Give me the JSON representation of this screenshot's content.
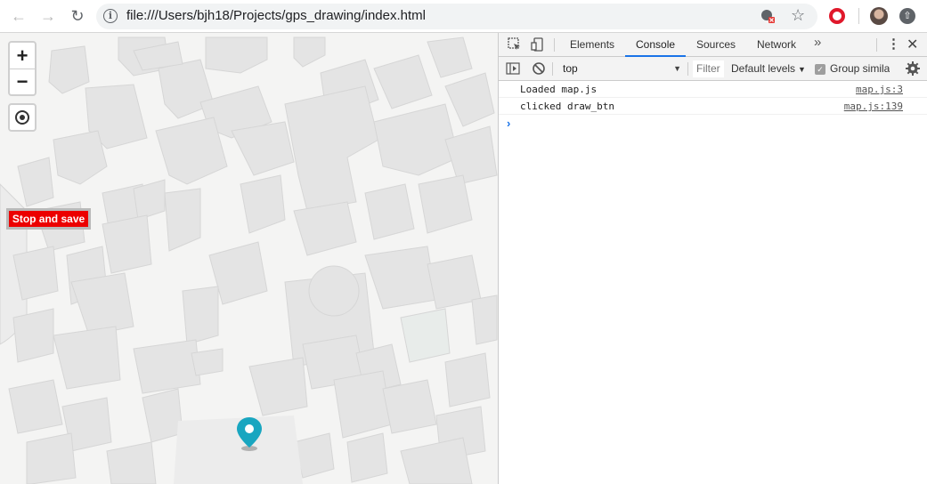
{
  "browser": {
    "url": "file:///Users/bjh18/Projects/gps_drawing/index.html",
    "icons": {
      "back": "arrow-back-icon",
      "forward": "arrow-forward-icon",
      "reload": "reload-icon",
      "info": "info-icon",
      "bookmark": "star-icon",
      "extension": "opera-icon",
      "profile": "avatar",
      "update": "update-icon"
    }
  },
  "map": {
    "zoom_in": "+",
    "zoom_out": "−",
    "stop_button_label": "Stop and save",
    "colors": {
      "background": "#f4f4f3",
      "buildings": "#e4e4e4",
      "building_outline": "#d7d7d7",
      "stop_button": "#ec0000",
      "marker": "#19a6c0"
    }
  },
  "devtools": {
    "tabs": [
      {
        "label": "Elements",
        "active": false
      },
      {
        "label": "Console",
        "active": true
      },
      {
        "label": "Sources",
        "active": false
      },
      {
        "label": "Network",
        "active": false
      }
    ],
    "more_tabs": "»",
    "context": "top",
    "filter_placeholder": "Filter",
    "levels": "Default levels",
    "group_similar_label": "Group similar",
    "group_similar_checked": true,
    "console_messages": [
      {
        "text": "Loaded map.js",
        "source": "map.js:3"
      },
      {
        "text": "clicked draw_btn",
        "source": "map.js:139"
      }
    ],
    "prompt": "›",
    "accent": "#1a73e8"
  }
}
